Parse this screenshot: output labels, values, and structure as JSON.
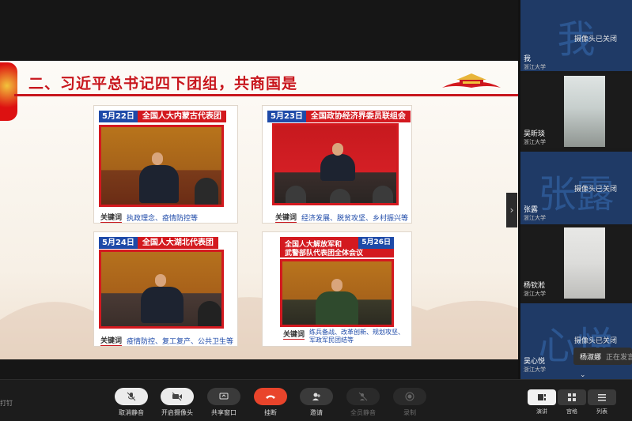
{
  "slide": {
    "title": "二、习近平总书记四下团组，共商国是",
    "cards": [
      {
        "date": "5月22日",
        "event": "全国人大内蒙古代表团",
        "kw_label": "关键词",
        "keywords": "执政理念、疫情防控等"
      },
      {
        "date": "5月23日",
        "event": "全国政协经济界委员联组会",
        "kw_label": "关键词",
        "keywords": "经济发展、脱贫攻坚、乡村振兴等"
      },
      {
        "date": "5月24日",
        "event": "全国人大湖北代表团",
        "kw_label": "关键词",
        "keywords": "疫情防控、复工复产、公共卫生等"
      },
      {
        "date": "5月26日",
        "event_line1": "全国人大解放军和",
        "event_line2": "武警部队代表团全体会议",
        "kw_label": "关键词",
        "keywords_line1": "练兵备战、改革创新、规划攻坚、",
        "keywords_line2": "军政军民团结等"
      }
    ]
  },
  "participants": [
    {
      "avatar_char": "我",
      "camera_status": "摄像头已关闭",
      "name": "我",
      "org": "浙江大学"
    },
    {
      "name": "吴昕琰",
      "org": "浙江大学"
    },
    {
      "avatar_char": "张露",
      "camera_status": "摄像头已关闭",
      "name": "张露",
      "org": "浙江大学"
    },
    {
      "name": "杨钦淞",
      "org": "浙江大学"
    },
    {
      "avatar_char": "心悦",
      "camera_status": "摄像头已关闭",
      "name": "吴心悦",
      "org": "浙江大学"
    }
  ],
  "toast": {
    "name": "杨淑娜",
    "status": "正在发言"
  },
  "toolbar": {
    "pin_label": "打钉",
    "buttons": [
      {
        "label": "取消静音",
        "icon": "mic-off-icon"
      },
      {
        "label": "开启摄像头",
        "icon": "camera-icon"
      },
      {
        "label": "共享窗口",
        "icon": "share-window-icon"
      },
      {
        "label": "挂断",
        "icon": "hangup-icon"
      },
      {
        "label": "邀请",
        "icon": "invite-icon"
      },
      {
        "label": "全员静音",
        "icon": "mute-all-icon"
      },
      {
        "label": "录制",
        "icon": "record-icon"
      }
    ],
    "views": [
      {
        "label": "演讲",
        "icon": "speaker-view-icon"
      },
      {
        "label": "宫格",
        "icon": "grid-view-icon"
      },
      {
        "label": "列表",
        "icon": "list-view-icon"
      }
    ]
  }
}
